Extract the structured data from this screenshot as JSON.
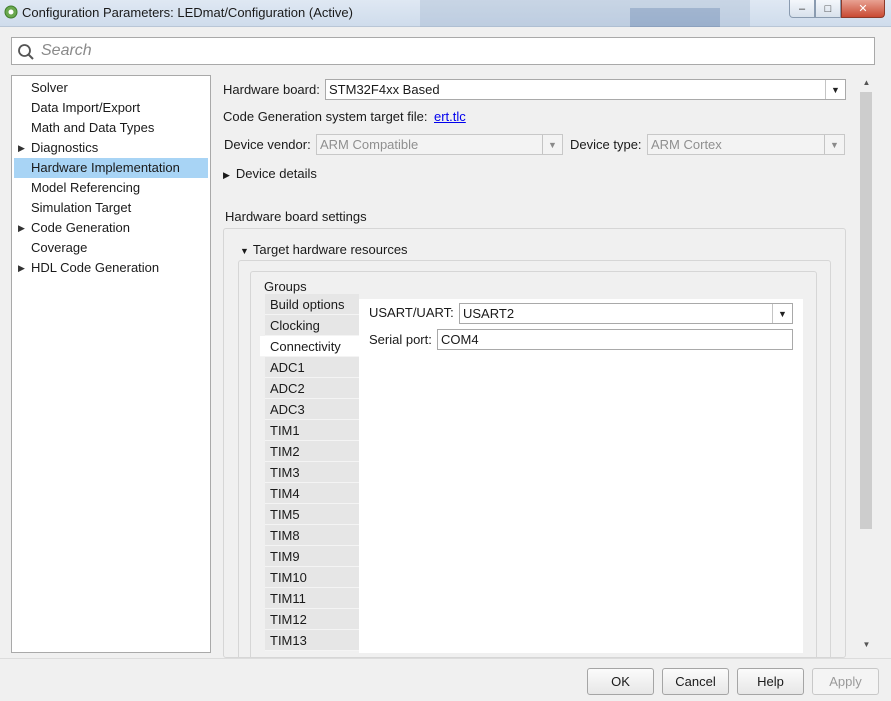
{
  "window": {
    "title": "Configuration Parameters: LEDmat/Configuration (Active)",
    "minimize_glyph": "–",
    "maximize_glyph": "□",
    "close_glyph": "✕"
  },
  "search": {
    "placeholder": "Search"
  },
  "tree": {
    "items": [
      {
        "label": "Solver",
        "expandable": false
      },
      {
        "label": "Data Import/Export",
        "expandable": false
      },
      {
        "label": "Math and Data Types",
        "expandable": false
      },
      {
        "label": "Diagnostics",
        "expandable": true
      },
      {
        "label": "Hardware Implementation",
        "expandable": false,
        "selected": true
      },
      {
        "label": "Model Referencing",
        "expandable": false
      },
      {
        "label": "Simulation Target",
        "expandable": false
      },
      {
        "label": "Code Generation",
        "expandable": true
      },
      {
        "label": "Coverage",
        "expandable": false
      },
      {
        "label": "HDL Code Generation",
        "expandable": true
      }
    ],
    "expand_glyph": "▶"
  },
  "hardware": {
    "board_label": "Hardware board:",
    "board_value": "STM32F4xx Based",
    "target_file_label": "Code Generation system target file:",
    "target_file_link": "ert.tlc",
    "vendor_label": "Device vendor:",
    "vendor_value": "ARM Compatible",
    "type_label": "Device type:",
    "type_value": "ARM Cortex",
    "device_details": "Device details",
    "board_settings": "Hardware board settings",
    "target_resources": "Target hardware resources",
    "groups_label": "Groups",
    "dropdown_glyph": "▼",
    "collapse_glyph": "▶",
    "expanded_glyph": "▼"
  },
  "groups": {
    "items": [
      "Build options",
      "Clocking",
      "Connectivity",
      "ADC1",
      "ADC2",
      "ADC3",
      "TIM1",
      "TIM2",
      "TIM3",
      "TIM4",
      "TIM5",
      "TIM8",
      "TIM9",
      "TIM10",
      "TIM11",
      "TIM12",
      "TIM13"
    ],
    "active_index": 2
  },
  "connectivity": {
    "usart_label": "USART/UART:",
    "usart_value": "USART2",
    "serial_label": "Serial port:",
    "serial_value": "COM4"
  },
  "scrollbar": {
    "up_glyph": "▲",
    "down_glyph": "▼"
  },
  "footer": {
    "ok": "OK",
    "cancel": "Cancel",
    "help": "Help",
    "apply": "Apply"
  }
}
